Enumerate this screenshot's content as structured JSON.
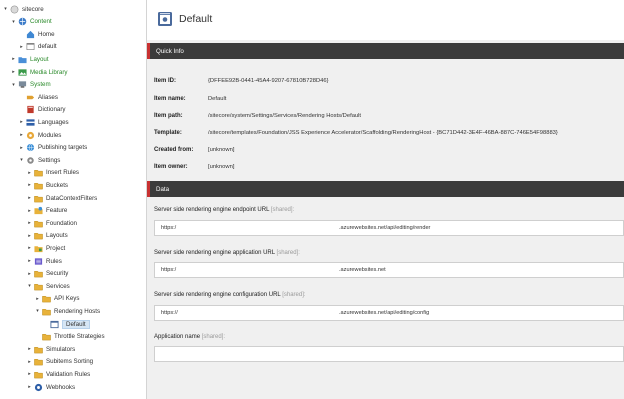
{
  "tree": {
    "items": [
      {
        "label": "sitecore",
        "indent": 0,
        "twisty": "▾",
        "icon": "sitecore-root-icon",
        "green": false
      },
      {
        "label": "Content",
        "indent": 1,
        "twisty": "▾",
        "icon": "content-icon",
        "green": true
      },
      {
        "label": "Home",
        "indent": 2,
        "twisty": "",
        "icon": "home-icon",
        "green": false
      },
      {
        "label": "default",
        "indent": 2,
        "twisty": "▸",
        "icon": "page-icon",
        "green": false
      },
      {
        "label": "Layout",
        "indent": 1,
        "twisty": "▸",
        "icon": "layout-icon",
        "green": true
      },
      {
        "label": "Media Library",
        "indent": 1,
        "twisty": "▸",
        "icon": "media-library-icon",
        "green": true
      },
      {
        "label": "System",
        "indent": 1,
        "twisty": "▾",
        "icon": "system-icon",
        "green": true
      },
      {
        "label": "Aliases",
        "indent": 2,
        "twisty": "",
        "icon": "aliases-icon",
        "green": false
      },
      {
        "label": "Dictionary",
        "indent": 2,
        "twisty": "",
        "icon": "dictionary-icon",
        "green": false
      },
      {
        "label": "Languages",
        "indent": 2,
        "twisty": "▸",
        "icon": "languages-icon",
        "green": false
      },
      {
        "label": "Modules",
        "indent": 2,
        "twisty": "▸",
        "icon": "modules-icon",
        "green": false
      },
      {
        "label": "Publishing targets",
        "indent": 2,
        "twisty": "▸",
        "icon": "publishing-targets-icon",
        "green": false
      },
      {
        "label": "Settings",
        "indent": 2,
        "twisty": "▾",
        "icon": "settings-icon",
        "green": false
      },
      {
        "label": "Insert Rules",
        "indent": 3,
        "twisty": "▸",
        "icon": "folder-icon",
        "green": false
      },
      {
        "label": "Buckets",
        "indent": 3,
        "twisty": "▸",
        "icon": "folder-icon",
        "green": false
      },
      {
        "label": "DataContextFilters",
        "indent": 3,
        "twisty": "▸",
        "icon": "folder-icon",
        "green": false
      },
      {
        "label": "Feature",
        "indent": 3,
        "twisty": "▸",
        "icon": "feature-icon",
        "green": false
      },
      {
        "label": "Foundation",
        "indent": 3,
        "twisty": "▸",
        "icon": "folder-icon",
        "green": false
      },
      {
        "label": "Layouts",
        "indent": 3,
        "twisty": "▸",
        "icon": "folder-icon",
        "green": false
      },
      {
        "label": "Project",
        "indent": 3,
        "twisty": "▸",
        "icon": "project-icon",
        "green": false
      },
      {
        "label": "Rules",
        "indent": 3,
        "twisty": "▸",
        "icon": "rules-icon",
        "green": false
      },
      {
        "label": "Security",
        "indent": 3,
        "twisty": "▸",
        "icon": "folder-icon",
        "green": false
      },
      {
        "label": "Services",
        "indent": 3,
        "twisty": "▾",
        "icon": "folder-icon",
        "green": false
      },
      {
        "label": "API Keys",
        "indent": 4,
        "twisty": "▸",
        "icon": "folder-icon",
        "green": false
      },
      {
        "label": "Rendering Hosts",
        "indent": 4,
        "twisty": "▾",
        "icon": "folder-icon",
        "green": false
      },
      {
        "label": "Default",
        "indent": 5,
        "twisty": "",
        "icon": "rendering-host-icon",
        "green": false,
        "selected": true
      },
      {
        "label": "Throttle Strategies",
        "indent": 4,
        "twisty": "",
        "icon": "folder-icon",
        "green": false
      },
      {
        "label": "Simulators",
        "indent": 3,
        "twisty": "▸",
        "icon": "folder-icon",
        "green": false
      },
      {
        "label": "Subitems Sorting",
        "indent": 3,
        "twisty": "▸",
        "icon": "folder-icon",
        "green": false
      },
      {
        "label": "Validation Rules",
        "indent": 3,
        "twisty": "▸",
        "icon": "folder-icon",
        "green": false
      },
      {
        "label": "Webhooks",
        "indent": 3,
        "twisty": "▸",
        "icon": "webhooks-icon",
        "green": false
      }
    ]
  },
  "header": {
    "title": "Default"
  },
  "quick_info": {
    "title": "Quick Info",
    "rows": [
      {
        "label": "Item ID:",
        "value": "{DFFEE92B-0441-45A4-9207-67810B728D46}"
      },
      {
        "label": "Item name:",
        "value": "Default"
      },
      {
        "label": "Item path:",
        "value": "/sitecore/system/Settings/Services/Rendering Hosts/Default"
      },
      {
        "label": "Template:",
        "value": "/sitecore/templates/Foundation/JSS Experience Accelerator/Scaffolding/RenderingHost - {BC71D442-3E4F-46BA-887C-746E54F98883}"
      },
      {
        "label": "Created from:",
        "value": "[unknown]"
      },
      {
        "label": "Item owner:",
        "value": "[unknown]"
      }
    ]
  },
  "data_section": {
    "title": "Data",
    "fields": [
      {
        "label": "Server side rendering engine endpoint URL",
        "shared": "[shared]:",
        "value_prefix": "https:/",
        "value_suffix": ".azurewebsites.net/api/editing/render"
      },
      {
        "label": "Server side rendering engine application URL",
        "shared": "[shared]:",
        "value_prefix": "https:/",
        "value_suffix": ".azurewebsites.net"
      },
      {
        "label": "Server side rendering engine configuration URL",
        "shared": "[shared]:",
        "value_prefix": "https://",
        "value_suffix": ".azurewebsites.net/api/editing/config"
      },
      {
        "label": "Application name",
        "shared": "[shared]:",
        "value_prefix": "",
        "value_suffix": ""
      }
    ]
  },
  "colors": {
    "accent": "#c83131",
    "section_bar": "#3b3b3b",
    "tree_green": "#2a8a2a",
    "selection": "#d6e6f5"
  }
}
